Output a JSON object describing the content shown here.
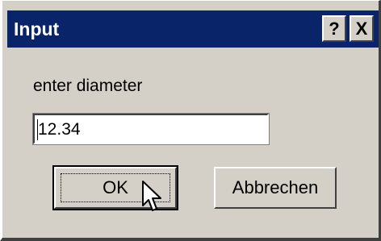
{
  "window": {
    "title": "Input",
    "help_label": "?",
    "close_label": "X"
  },
  "prompt": {
    "label": "enter diameter"
  },
  "input": {
    "value": "12.34"
  },
  "buttons": {
    "ok_label": "OK",
    "cancel_label": "Abbrechen"
  },
  "colors": {
    "titlebar": "#0a246a",
    "face": "#d4d0c8"
  },
  "icons": {
    "cursor": "mouse-pointer-icon"
  }
}
